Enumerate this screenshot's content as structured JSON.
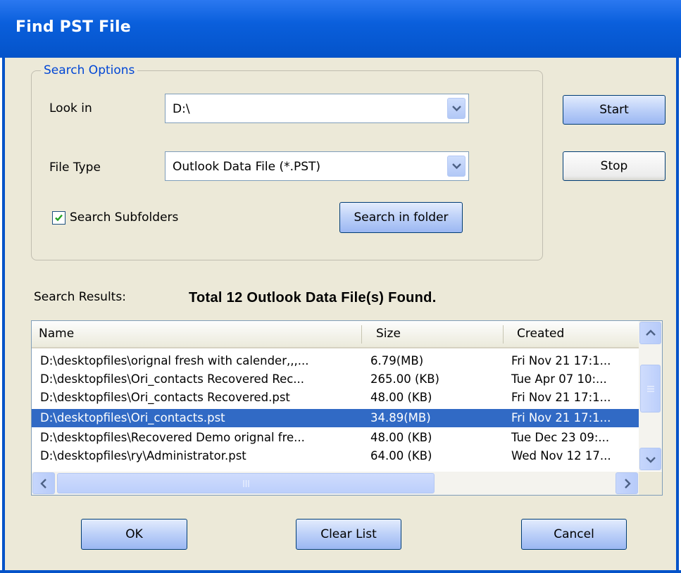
{
  "window": {
    "title": "Find PST File"
  },
  "search_options": {
    "legend": "Search Options",
    "look_in_label": "Look in",
    "look_in_value": "D:\\",
    "file_type_label": "File Type",
    "file_type_value": "Outlook Data File (*.PST)",
    "subfolders_label": "Search Subfolders",
    "subfolders_checked": true,
    "search_in_folder_label": "Search in folder"
  },
  "side_buttons": {
    "start": "Start",
    "stop": "Stop"
  },
  "results": {
    "label": "Search Results:",
    "summary": "Total 12 Outlook Data File(s) Found.",
    "columns": [
      "Name",
      "Size",
      "Created"
    ],
    "rows": [
      {
        "name": "D:\\desktopfiles\\orignal fresh with calender,,,...",
        "size": "6.79(MB)",
        "created": "Fri Nov 21 17:1...",
        "selected": false
      },
      {
        "name": "D:\\desktopfiles\\Ori_contacts Recovered Rec...",
        "size": "265.00 (KB)",
        "created": "Tue Apr 07 10:...",
        "selected": false
      },
      {
        "name": "D:\\desktopfiles\\Ori_contacts Recovered.pst",
        "size": "48.00 (KB)",
        "created": "Fri Nov 21 17:1...",
        "selected": false
      },
      {
        "name": "D:\\desktopfiles\\Ori_contacts.pst",
        "size": "34.89(MB)",
        "created": "Fri Nov 21 17:1...",
        "selected": true
      },
      {
        "name": "D:\\desktopfiles\\Recovered Demo orignal fre...",
        "size": "48.00 (KB)",
        "created": "Tue Dec 23 09:...",
        "selected": false
      },
      {
        "name": "D:\\desktopfiles\\ry\\Administrator.pst",
        "size": "64.00 (KB)",
        "created": "Wed Nov 12 17...",
        "selected": false
      }
    ],
    "selection_color": "#316ac5"
  },
  "footer": {
    "ok": "OK",
    "clear_list": "Clear List",
    "cancel": "Cancel"
  },
  "icons": [
    "dropdown-arrow-icon",
    "checkmark-icon",
    "scroll-up-icon",
    "scroll-down-icon",
    "scroll-left-icon",
    "scroll-right-icon",
    "grip-icon"
  ]
}
